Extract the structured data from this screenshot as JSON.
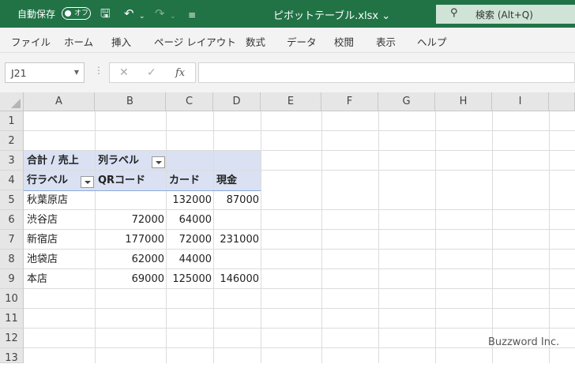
{
  "titlebar": {
    "autosave_label": "自動保存",
    "autosave_state": "オフ",
    "filename": "ピボットテーブル.xlsx",
    "filename_chevron": "⌄",
    "search_placeholder": "検索 (Alt+Q)"
  },
  "ribbon": {
    "tabs": [
      "ファイル",
      "ホーム",
      "挿入",
      "ページ レイアウト",
      "数式",
      "データ",
      "校閲",
      "表示",
      "ヘルプ"
    ]
  },
  "formula_bar": {
    "name_box": "J21",
    "formula": ""
  },
  "sheet": {
    "columns": [
      "A",
      "B",
      "C",
      "D",
      "E",
      "F",
      "G",
      "H",
      "I"
    ],
    "rows": [
      "1",
      "2",
      "3",
      "4",
      "5",
      "6",
      "7",
      "8",
      "9",
      "10",
      "11",
      "12",
      "13"
    ],
    "pivot": {
      "row3": {
        "a": "合計 / 売上",
        "b": "列ラベル"
      },
      "row4": {
        "a": "行ラベル",
        "b": "QRコード",
        "c": "カード",
        "d": "現金"
      },
      "data": [
        {
          "a": "秋葉原店",
          "b": "",
          "c": "132000",
          "d": "87000"
        },
        {
          "a": "渋谷店",
          "b": "72000",
          "c": "64000",
          "d": ""
        },
        {
          "a": "新宿店",
          "b": "177000",
          "c": "72000",
          "d": "231000"
        },
        {
          "a": "池袋店",
          "b": "62000",
          "c": "44000",
          "d": ""
        },
        {
          "a": "本店",
          "b": "69000",
          "c": "125000",
          "d": "146000"
        }
      ]
    }
  },
  "watermark": "Buzzword Inc."
}
